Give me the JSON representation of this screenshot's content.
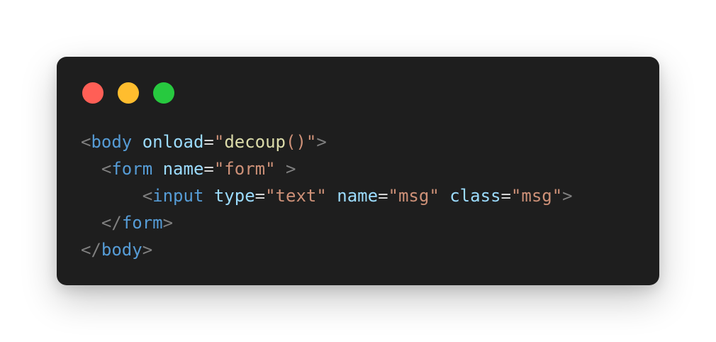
{
  "window": {
    "controls": {
      "close_color": "#ff5f56",
      "minimize_color": "#ffbd2e",
      "maximize_color": "#27c93f"
    }
  },
  "code_lines": [
    {
      "indent": "",
      "tokens": [
        {
          "type": "punct",
          "text": "<"
        },
        {
          "type": "tag",
          "text": "body"
        },
        {
          "type": "plain",
          "text": " "
        },
        {
          "type": "attr",
          "text": "onload"
        },
        {
          "type": "eq",
          "text": "="
        },
        {
          "type": "str",
          "text": "\""
        },
        {
          "type": "fn",
          "text": "decoup"
        },
        {
          "type": "str",
          "text": "()"
        },
        {
          "type": "str",
          "text": "\""
        },
        {
          "type": "punct",
          "text": ">"
        }
      ]
    },
    {
      "indent": "  ",
      "tokens": [
        {
          "type": "punct",
          "text": "<"
        },
        {
          "type": "tag",
          "text": "form"
        },
        {
          "type": "plain",
          "text": " "
        },
        {
          "type": "attr",
          "text": "name"
        },
        {
          "type": "eq",
          "text": "="
        },
        {
          "type": "str",
          "text": "\"form\""
        },
        {
          "type": "plain",
          "text": " "
        },
        {
          "type": "punct",
          "text": ">"
        }
      ]
    },
    {
      "indent": "      ",
      "tokens": [
        {
          "type": "punct",
          "text": "<"
        },
        {
          "type": "tag",
          "text": "input"
        },
        {
          "type": "plain",
          "text": " "
        },
        {
          "type": "attr",
          "text": "type"
        },
        {
          "type": "eq",
          "text": "="
        },
        {
          "type": "str",
          "text": "\"text\""
        },
        {
          "type": "plain",
          "text": " "
        },
        {
          "type": "attr",
          "text": "name"
        },
        {
          "type": "eq",
          "text": "="
        },
        {
          "type": "str",
          "text": "\"msg\""
        },
        {
          "type": "plain",
          "text": " "
        },
        {
          "type": "attr",
          "text": "class"
        },
        {
          "type": "eq",
          "text": "="
        },
        {
          "type": "str",
          "text": "\"msg\""
        },
        {
          "type": "punct",
          "text": ">"
        }
      ]
    },
    {
      "indent": "  ",
      "tokens": [
        {
          "type": "punct",
          "text": "</"
        },
        {
          "type": "tag",
          "text": "form"
        },
        {
          "type": "punct",
          "text": ">"
        }
      ]
    },
    {
      "indent": "",
      "tokens": [
        {
          "type": "punct",
          "text": "</"
        },
        {
          "type": "tag",
          "text": "body"
        },
        {
          "type": "punct",
          "text": ">"
        }
      ]
    }
  ]
}
